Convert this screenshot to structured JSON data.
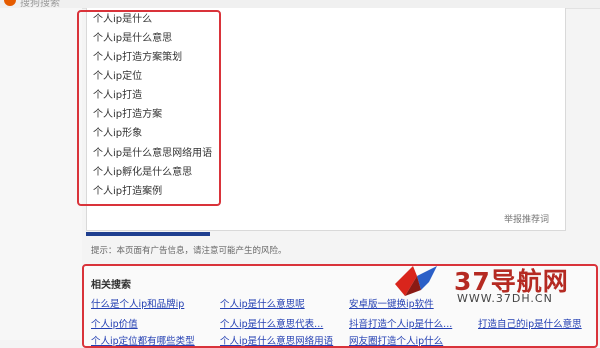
{
  "header": {
    "logo_text": "搜狗搜索"
  },
  "suggestions": [
    "个人ip是什么",
    "个人ip是什么意思",
    "个人ip打造方案策划",
    "个人ip定位",
    "个人ip打造",
    "个人ip打造方案",
    "个人ip形象",
    "个人ip是什么意思网络用语",
    "个人ip孵化是什么意思",
    "个人ip打造案例"
  ],
  "report_link": "举报推荐词",
  "notice": "提示：本页面有广告信息，请注意可能产生的风险。",
  "related": {
    "title": "相关搜索",
    "links": [
      "什么是个人ip和品牌ip",
      "个人ip是什么意思呢",
      "安卓版一键换ip软件",
      "个人ip价值",
      "个人ip是什么意思代表...",
      "抖音打造个人ip是什么...",
      "打造自己的ip是什么意思",
      "个人ip定位都有哪些类型",
      "个人ip是什么意思网络用语",
      "网友圈打造个人ip什么"
    ]
  },
  "watermark": {
    "name": "37导航网",
    "url": "WWW.37DH.CN"
  },
  "colors": {
    "highlight": "#d9333a",
    "link": "#2440b3",
    "accent_bar": "#1f3f8f"
  }
}
